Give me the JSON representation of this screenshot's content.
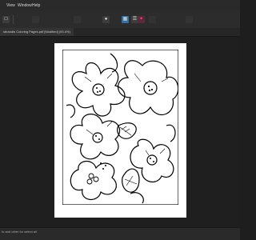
{
  "menu": {
    "items": [
      "View",
      "Window",
      "Help"
    ]
  },
  "toolbar": {
    "buttons": [
      "document-icon",
      "tool-icon",
      "tool-icon",
      "tool-icon",
      "persona-icon",
      "persona-icon",
      "brush-icon"
    ]
  },
  "document": {
    "tab_title": "sbrandis Coloring Pages.pdf [Modified] (93.4%)"
  },
  "status": {
    "text": "to and other for select all"
  },
  "colors": {
    "accent_blue": "#3a6d9c",
    "accent_pink": "#c0386a",
    "background": "#1e1e1e"
  }
}
